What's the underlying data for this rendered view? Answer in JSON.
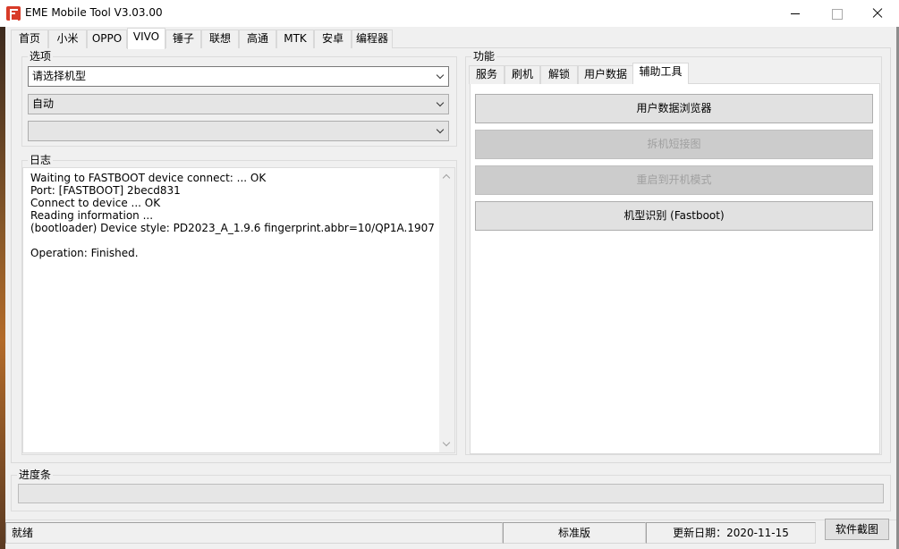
{
  "window": {
    "title": "EME Mobile Tool V3.03.00",
    "icon": "app-logo-icon"
  },
  "main_tabs": [
    {
      "label": "首页"
    },
    {
      "label": "小米"
    },
    {
      "label": "OPPO"
    },
    {
      "label": "VIVO",
      "active": true
    },
    {
      "label": "锤子"
    },
    {
      "label": "联想"
    },
    {
      "label": "高通"
    },
    {
      "label": "MTK"
    },
    {
      "label": "安卓"
    },
    {
      "label": "编程器"
    }
  ],
  "options": {
    "title": "选项",
    "model_select": "请选择机型",
    "mode_select": "自动",
    "third_select": ""
  },
  "log": {
    "title": "日志",
    "lines": [
      "Waiting to FASTBOOT device connect: ... OK",
      "Port: [FASTBOOT] 2becd831",
      "Connect to device ... OK",
      "Reading information ...",
      "(bootloader) Device style: PD2023_A_1.9.6 fingerprint.abbr=10/QP1A.1907",
      "",
      "Operation: Finished."
    ]
  },
  "functions": {
    "title": "功能",
    "tabs": [
      {
        "label": "服务"
      },
      {
        "label": "刷机"
      },
      {
        "label": "解锁"
      },
      {
        "label": "用户数据"
      },
      {
        "label": "辅助工具",
        "active": true
      }
    ],
    "buttons": [
      {
        "label": "用户数据浏览器",
        "enabled": true
      },
      {
        "label": "拆机短接图",
        "enabled": false
      },
      {
        "label": "重启到开机模式",
        "enabled": false
      },
      {
        "label": "机型识别 (Fastboot)",
        "enabled": true
      }
    ]
  },
  "progress": {
    "title": "进度条",
    "value": 0
  },
  "statusbar": {
    "status": "就绪",
    "edition": "标准版",
    "update_date": "更新日期：2020-11-15",
    "screenshot_label": "软件截图"
  }
}
